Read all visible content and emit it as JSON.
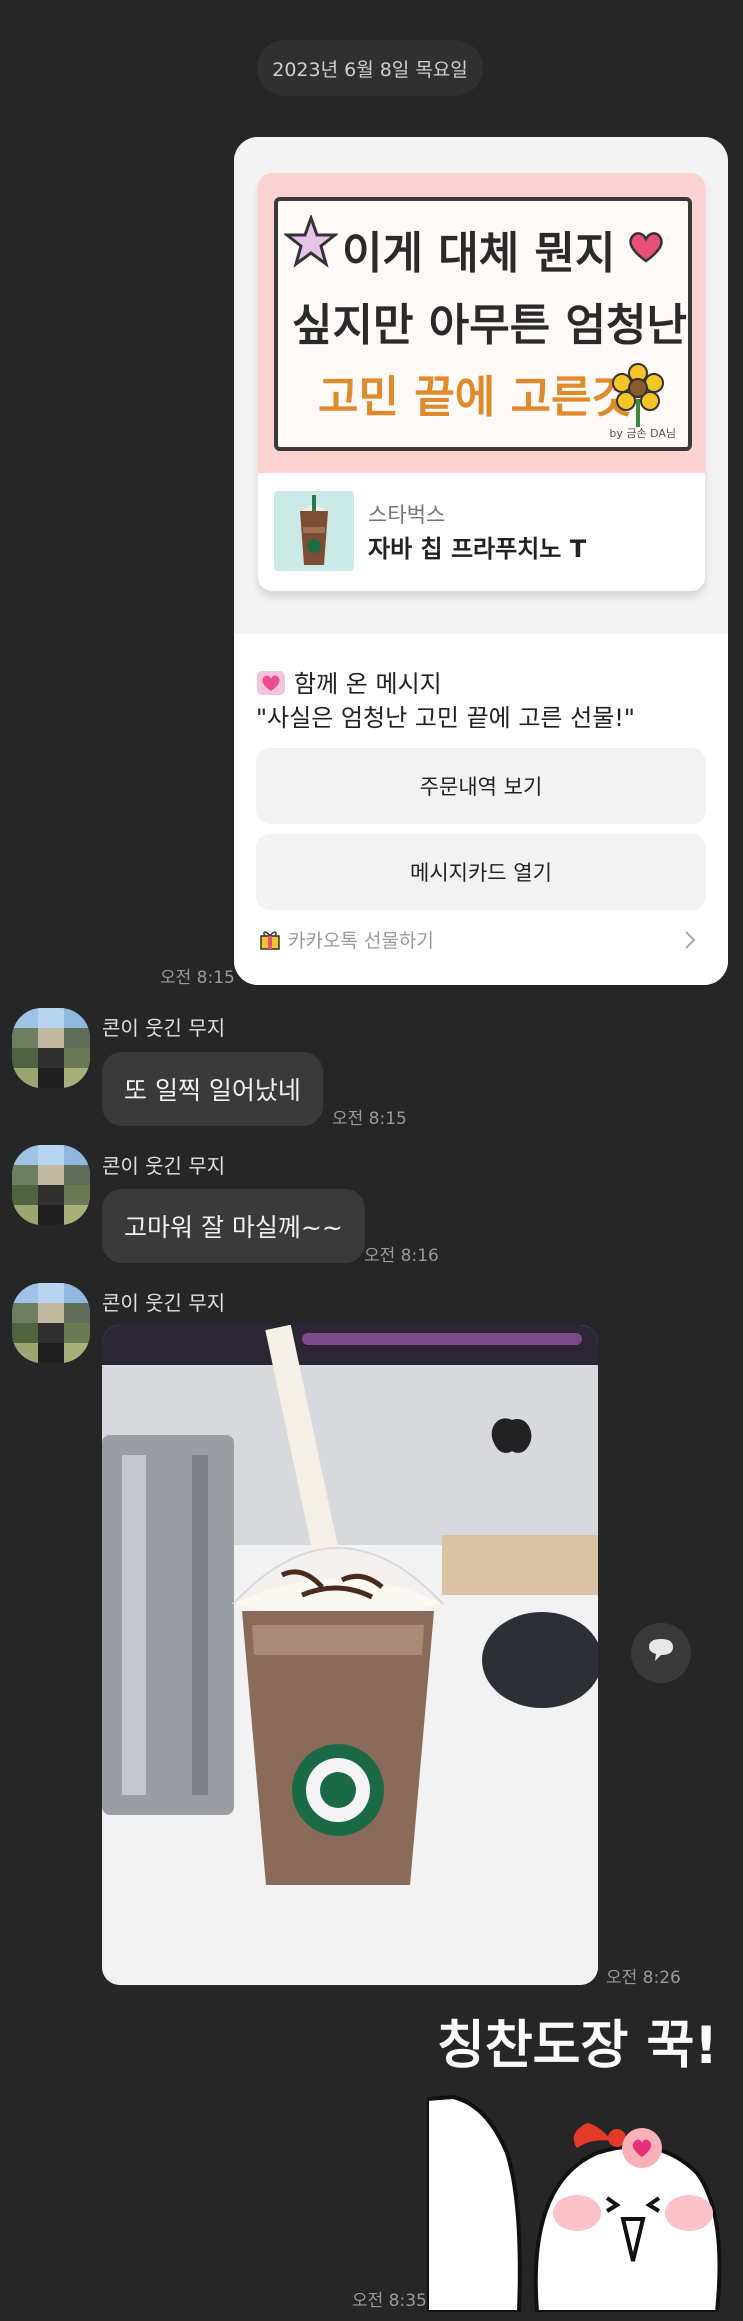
{
  "date_divider": "2023년 6월 8일 목요일",
  "gift_message": {
    "card_text": {
      "line1": "이게 대체 뭔지",
      "line2": "싶지만 아무튼 엄청난",
      "line3": "고민 끝에 고른것",
      "byline": "by 금손 DA님"
    },
    "product_brand": "스타벅스",
    "product_name": "자바 칩 프라푸치노 T",
    "note_header": "함께 온 메시지",
    "note_text": "\"사실은 엄청난 고민 끝에 고른 선물!\"",
    "order_button": "주문내역 보기",
    "card_button": "메시지카드 열기",
    "footer_label": "카카오톡 선물하기",
    "time": "오전 8:15"
  },
  "messages": [
    {
      "sender": "콘이 웃긴 무지",
      "text": "또 일찍 일어났네",
      "time": "오전 8:15"
    },
    {
      "sender": "콘이 웃긴 무지",
      "text": "고마워 잘 마실께~~",
      "time": "오전 8:16"
    },
    {
      "sender": "콘이 웃긴 무지",
      "time": "오전 8:26"
    }
  ],
  "sticker": {
    "text": "칭찬도장 꾹!",
    "time": "오전 8:35"
  },
  "icons": {
    "footer": "gift-box-icon",
    "chevron": "chevron-right-icon",
    "share": "speech-bubble-icon",
    "heart": "heart-icon"
  },
  "colors": {
    "background": "#262626",
    "bubble": "#3a3a3a",
    "card_banner": "#fbd2cf",
    "heart_pink": "#e8507a"
  }
}
